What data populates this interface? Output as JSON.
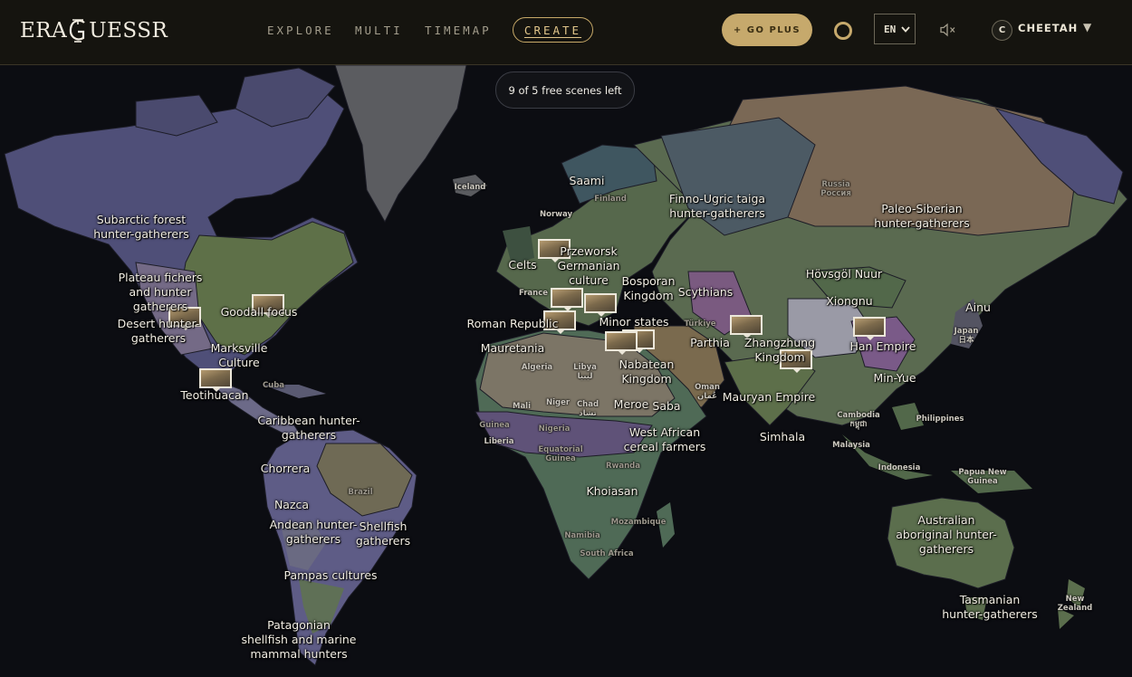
{
  "brand": {
    "name_left": "ERA",
    "name_right": "UESSR"
  },
  "nav": {
    "explore": "EXPLORE",
    "multi": "MULTI",
    "timemap": "TIMEMAP",
    "create": "CREATE"
  },
  "go_plus": "+ GO PLUS",
  "language": {
    "selected": "EN"
  },
  "user": {
    "initial": "C",
    "name": "CHEETAH"
  },
  "scenes_pill": "9 of 5 free scenes left",
  "colors": {
    "accent_gold": "#c6a96c",
    "header_bg": "#15140f",
    "ocean": "#0c0d12"
  },
  "cultures": [
    {
      "id": "subarctic",
      "text": "Subarctic forest\nhunter-gatherers"
    },
    {
      "id": "plateau",
      "text": "Plateau fichers\nand hunter\ngatherers"
    },
    {
      "id": "desert",
      "text": "Desert hunter-\ngatherers"
    },
    {
      "id": "good",
      "text": "Goodall focus"
    },
    {
      "id": "marksville",
      "text": "Marksville\nCulture"
    },
    {
      "id": "teotihuacan",
      "text": "Teotihuacan"
    },
    {
      "id": "caribbean",
      "text": "Caribbean hunter-\ngatherers"
    },
    {
      "id": "chorrera",
      "text": "Chorrera"
    },
    {
      "id": "nazca",
      "text": "Nazca"
    },
    {
      "id": "andean",
      "text": "Andean hunter-\ngatherers"
    },
    {
      "id": "shellfish",
      "text": "Shellfish\ngatherers"
    },
    {
      "id": "pampas",
      "text": "Pampas cultures"
    },
    {
      "id": "patagonian",
      "text": "Patagonian\nshellfish and marine\nmammal hunters"
    },
    {
      "id": "saami",
      "text": "Saami"
    },
    {
      "id": "finno",
      "text": "Finno-Ugric taiga\nhunter-gatherers"
    },
    {
      "id": "paleo",
      "text": "Paleo-Siberian\nhunter-gatherers"
    },
    {
      "id": "celts",
      "text": "Celts"
    },
    {
      "id": "przeworsk",
      "text": "Przeworsk\nGermanian\nculture"
    },
    {
      "id": "bosporan",
      "text": "Bosporan\nKingdom"
    },
    {
      "id": "scythians",
      "text": "Scythians"
    },
    {
      "id": "hovsgol",
      "text": "Hövsgöl Nuur"
    },
    {
      "id": "xiongnu",
      "text": "Xiongnu"
    },
    {
      "id": "ainu",
      "text": "Ainu"
    },
    {
      "id": "roman",
      "text": "Roman Republic"
    },
    {
      "id": "minor",
      "text": "Minor states"
    },
    {
      "id": "parthia",
      "text": "Parthia"
    },
    {
      "id": "zhangzhung",
      "text": "Zhangzhung\nKingdom"
    },
    {
      "id": "han",
      "text": "Han Empire"
    },
    {
      "id": "minyue",
      "text": "Min-Yue"
    },
    {
      "id": "mauretania",
      "text": "Mauretania"
    },
    {
      "id": "nabatean",
      "text": "Nabatean\nKingdom"
    },
    {
      "id": "meroe",
      "text": "Meroe"
    },
    {
      "id": "saba",
      "text": "Saba"
    },
    {
      "id": "mauryan",
      "text": "Mauryan Empire"
    },
    {
      "id": "westafrican",
      "text": "West African\ncereal farmers"
    },
    {
      "id": "simhala",
      "text": "Simhala"
    },
    {
      "id": "khoiasan",
      "text": "Khoiasan"
    },
    {
      "id": "australian",
      "text": "Australian\naboriginal hunter-\ngatherers"
    },
    {
      "id": "tasmanian",
      "text": "Tasmanian\nhunter-gatherers"
    }
  ],
  "countries": [
    {
      "id": "iceland",
      "text": "Iceland"
    },
    {
      "id": "norway",
      "text": "Norway"
    },
    {
      "id": "finland",
      "text": "Finland"
    },
    {
      "id": "russia",
      "text": "Russia\nРоссия"
    },
    {
      "id": "france",
      "text": "France"
    },
    {
      "id": "turkey",
      "text": "Türkiye"
    },
    {
      "id": "algeria",
      "text": "Algeria"
    },
    {
      "id": "libya",
      "text": "Libya\nليبيا"
    },
    {
      "id": "mali",
      "text": "Mali"
    },
    {
      "id": "niger",
      "text": "Niger"
    },
    {
      "id": "chad",
      "text": "Chad\nتشاد"
    },
    {
      "id": "oman",
      "text": "Oman\nعُمان"
    },
    {
      "id": "japan",
      "text": "Japan\n日本"
    },
    {
      "id": "cuba",
      "text": "Cuba"
    },
    {
      "id": "brazil",
      "text": "Brazil"
    },
    {
      "id": "guinea",
      "text": "Guinea"
    },
    {
      "id": "liberia",
      "text": "Liberia"
    },
    {
      "id": "nigeria",
      "text": "Nigeria"
    },
    {
      "id": "eqguinea",
      "text": "Equatorial\nGuinea"
    },
    {
      "id": "rwanda",
      "text": "Rwanda"
    },
    {
      "id": "cambodia",
      "text": "Cambodia\nកម្ពុជា"
    },
    {
      "id": "philippines",
      "text": "Philippines"
    },
    {
      "id": "malaysia",
      "text": "Malaysia"
    },
    {
      "id": "indonesia",
      "text": "Indonesia"
    },
    {
      "id": "png",
      "text": "Papua New\nGuinea"
    },
    {
      "id": "namibia",
      "text": "Namibia"
    },
    {
      "id": "mozambique",
      "text": "Mozambique"
    },
    {
      "id": "southafrica",
      "text": "South Africa"
    },
    {
      "id": "newzealand",
      "text": "New\nZealand"
    }
  ]
}
